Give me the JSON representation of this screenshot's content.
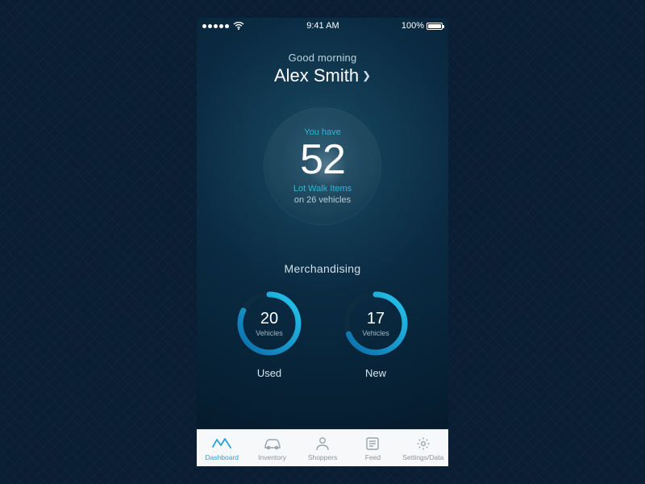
{
  "statusbar": {
    "time": "9:41 AM",
    "battery_pct": "100%"
  },
  "greeting": {
    "line1": "Good morning",
    "name": "Alex Smith"
  },
  "summary": {
    "you_have": "You have",
    "count": "52",
    "label": "Lot Walk Items",
    "subline": "on 26 vehicles"
  },
  "merch": {
    "title": "Merchandising",
    "used": {
      "count": "20",
      "unit": "Vehicles",
      "label": "Used"
    },
    "new": {
      "count": "17",
      "unit": "Vehicles",
      "label": "New"
    }
  },
  "tabs": {
    "dashboard": "Dashboard",
    "inventory": "Inventory",
    "shoppers": "Shoppers",
    "feed": "Feed",
    "settings": "Settings/Data"
  },
  "colors": {
    "accent": "#2fb6d8",
    "ring1": "#1fa8e0",
    "ring2": "#17c4ef"
  }
}
